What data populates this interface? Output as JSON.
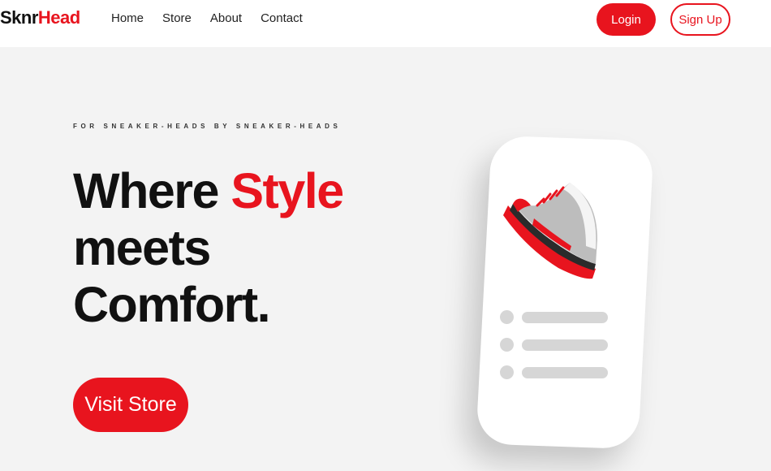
{
  "brand": {
    "part1": "Sknr",
    "part2": "Head"
  },
  "nav": {
    "items": [
      "Home",
      "Store",
      "About",
      "Contact"
    ]
  },
  "auth": {
    "login_label": "Login",
    "signup_label": "Sign Up"
  },
  "hero": {
    "eyebrow": "FOR SNEAKER-HEADS BY SNEAKER-HEADS",
    "headline_part1": "Where ",
    "headline_accent": "Style",
    "headline_line2": "meets",
    "headline_line3": "Comfort.",
    "cta_label": "Visit Store"
  },
  "illustration": {
    "icon": "sneaker-icon",
    "list_rows": 3
  },
  "colors": {
    "accent": "#e8141e",
    "background": "#f3f3f3",
    "text": "#111111"
  }
}
